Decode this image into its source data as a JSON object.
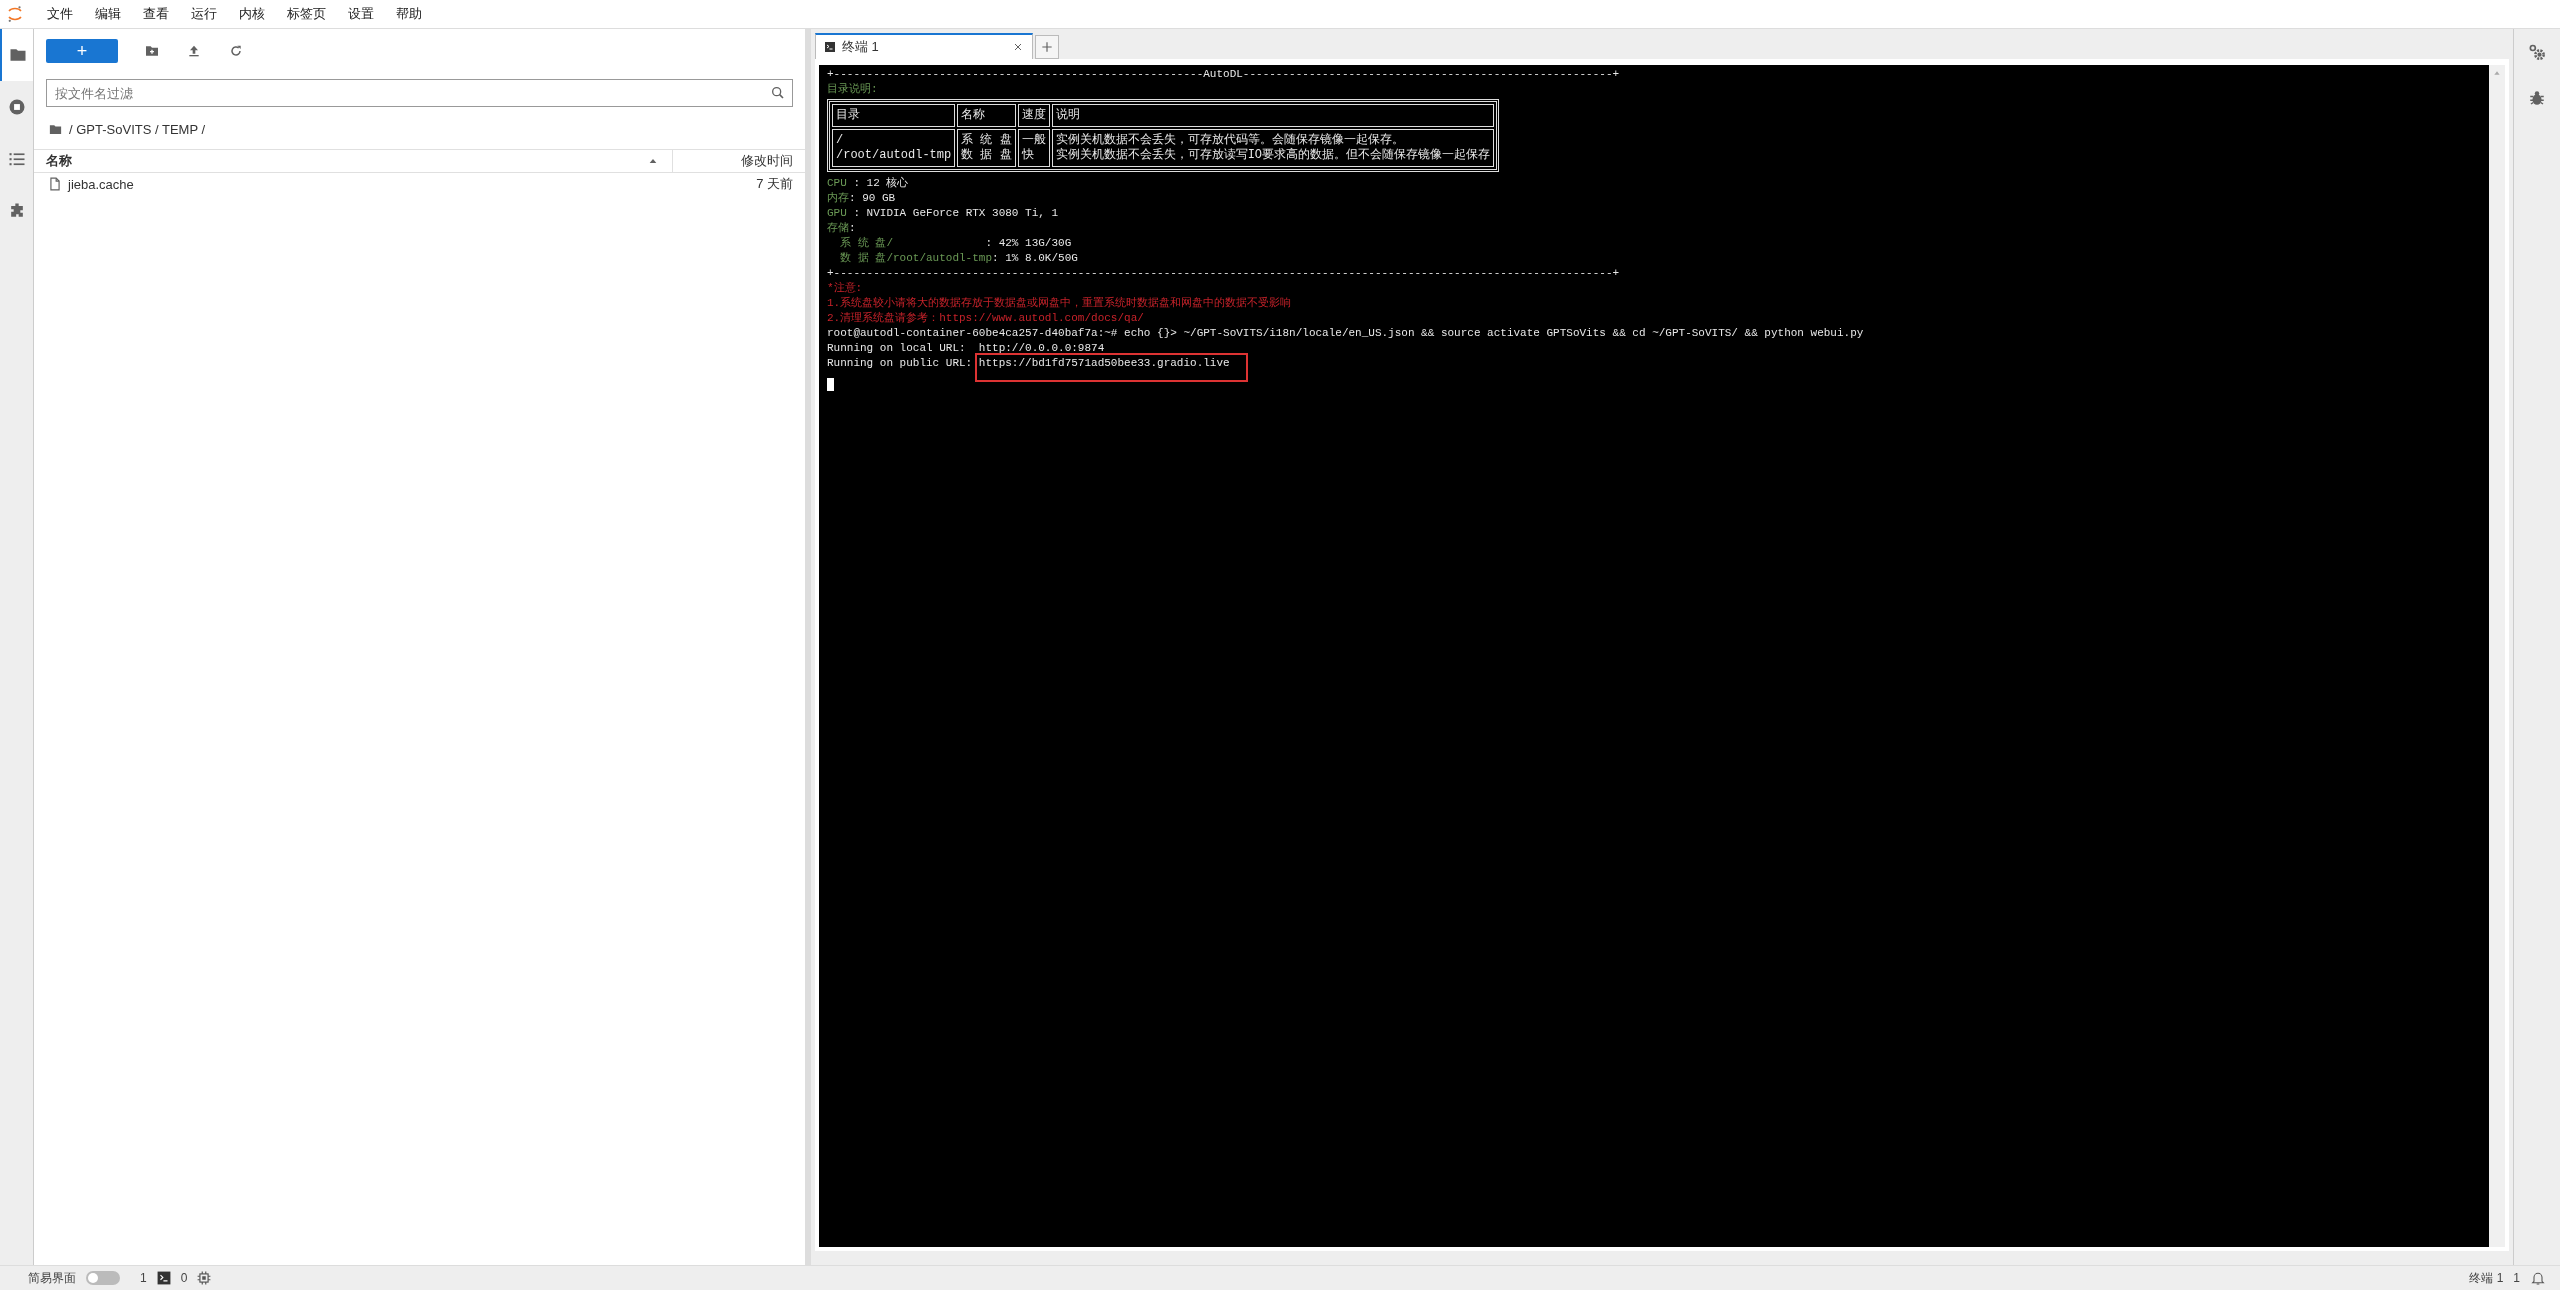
{
  "menu_bar": {
    "items": [
      "文件",
      "编辑",
      "查看",
      "运行",
      "内核",
      "标签页",
      "设置",
      "帮助"
    ]
  },
  "left_sidebar": {
    "items": [
      {
        "kind": "folder",
        "selected": true
      },
      {
        "kind": "running",
        "selected": false
      },
      {
        "kind": "toc",
        "selected": false
      },
      {
        "kind": "extensions",
        "selected": false
      }
    ]
  },
  "file_browser": {
    "new_button": "+",
    "filter": {
      "placeholder": "按文件名过滤"
    },
    "breadcrumb": "/ GPT-SoVITS / TEMP /",
    "columns": [
      "名称",
      "修改时间"
    ],
    "rows": [
      {
        "name": "jieba.cache",
        "modified": "7 天前",
        "selected": false
      }
    ]
  },
  "tabs": [
    {
      "label": "终端 1",
      "selected": true
    }
  ],
  "terminal": {
    "blocks": [
      {
        "kind": "rule",
        "text": "+--------------------------------------------------------AutoDL--------------------------------------------------------+"
      },
      {
        "kind": "heading",
        "text": "目录说明:"
      },
      {
        "kind": "table",
        "columns": [
          "目录",
          "名称",
          "速度",
          "说明"
        ],
        "rows": [
          [
            [
              "/",
              "/root/autodl-tmp"
            ],
            [
              "系 统 盘",
              "数 据 盘"
            ],
            [
              "一般",
              "快"
            ],
            [
              "实例关机数据不会丢失，可存放代码等。会随保存镜像一起保存。",
              "实例关机数据不会丢失，可存放读写IO要求高的数据。但不会随保存镜像一起保存"
            ]
          ]
        ]
      },
      {
        "kind": "field",
        "label": "CPU",
        "text": " : 12 核心"
      },
      {
        "kind": "field",
        "label": "内存",
        "text": ": 90 GB"
      },
      {
        "kind": "field",
        "label": "GPU",
        "text": " : NVIDIA GeForce RTX 3080 Ti, 1"
      },
      {
        "kind": "field",
        "label": "存储",
        "text": ":"
      },
      {
        "kind": "field",
        "label": "  系 统 盘/",
        "text": "              : 42% 13G/30G"
      },
      {
        "kind": "field",
        "label": "  数 据 盘/root/autodl-tmp",
        "text": ": 1% 8.0K/50G"
      },
      {
        "kind": "rule",
        "text": "+----------------------------------------------------------------------------------------------------------------------+"
      },
      {
        "kind": "warn",
        "text": "*注意:"
      },
      {
        "kind": "warn",
        "text": "1.系统盘较小请将大的数据存放于数据盘或网盘中，重置系统时数据盘和网盘中的数据不受影响"
      },
      {
        "kind": "warn",
        "text": "2.清理系统盘请参考：https://www.autodl.com/docs/qa/"
      },
      {
        "kind": "plain",
        "text": "root@autodl-container-60be4ca257-d40baf7a:~# echo {}> ~/GPT-SoVITS/i18n/locale/en_US.json && source activate GPTSoVits && cd ~/GPT-SoVITS/ && python webui.py"
      },
      {
        "kind": "plain",
        "text": "Running on local URL:  http://0.0.0.0:9874"
      },
      {
        "kind": "url",
        "label": "Running on public URL: ",
        "text": "https://bd1fd7571ad50bee33.gradio.live"
      },
      {
        "kind": "cursor"
      }
    ]
  },
  "status_bar": {
    "simple_mode": {
      "label": "简易界面",
      "on": false
    },
    "terminals": "1",
    "kernels": "0",
    "right_label": "终端 1",
    "notifications": "1"
  }
}
